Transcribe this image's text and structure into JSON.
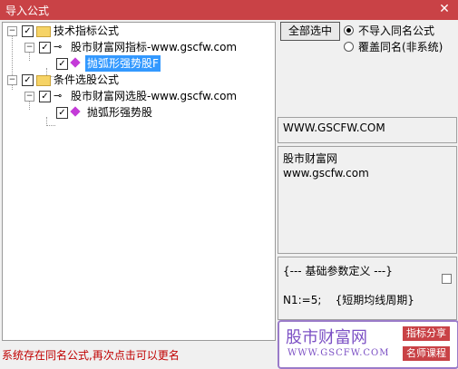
{
  "window": {
    "title": "导入公式",
    "close_glyph": "✕"
  },
  "tree": {
    "nodes": [
      {
        "label": "技术指标公式",
        "checked": true
      },
      {
        "label": "股市财富网指标-www.gscfw.com",
        "checked": true
      },
      {
        "label": "抛弧形强势股F",
        "checked": true,
        "selected": true
      },
      {
        "label": "条件选股公式",
        "checked": true
      },
      {
        "label": "股市财富网选股-www.gscfw.com",
        "checked": true
      },
      {
        "label": "抛弧形强势股",
        "checked": true
      }
    ]
  },
  "controls": {
    "select_all_label": "全部选中",
    "radio_no_import": "不导入同名公式",
    "radio_overwrite": "覆盖同名(非系统)"
  },
  "info": {
    "site": "WWW.GSCFW.COM",
    "desc_line1": "股市财富网",
    "desc_line2": "www.gscfw.com",
    "param_line1": "{--- 基础参数定义 ---}",
    "param_line2": "N1:=5;    {短期均线周期}"
  },
  "status_text": "系统存在同名公式,再次点击可以更名",
  "watermark": {
    "name": "股市财富网",
    "url": "WWW.GSCFW.COM",
    "tag1": "指标分享",
    "tag2": "名师课程"
  },
  "colors": {
    "title_bar": "#c94246",
    "selection": "#3399ff",
    "status": "#c00000",
    "watermark": "#7b4fc4"
  }
}
